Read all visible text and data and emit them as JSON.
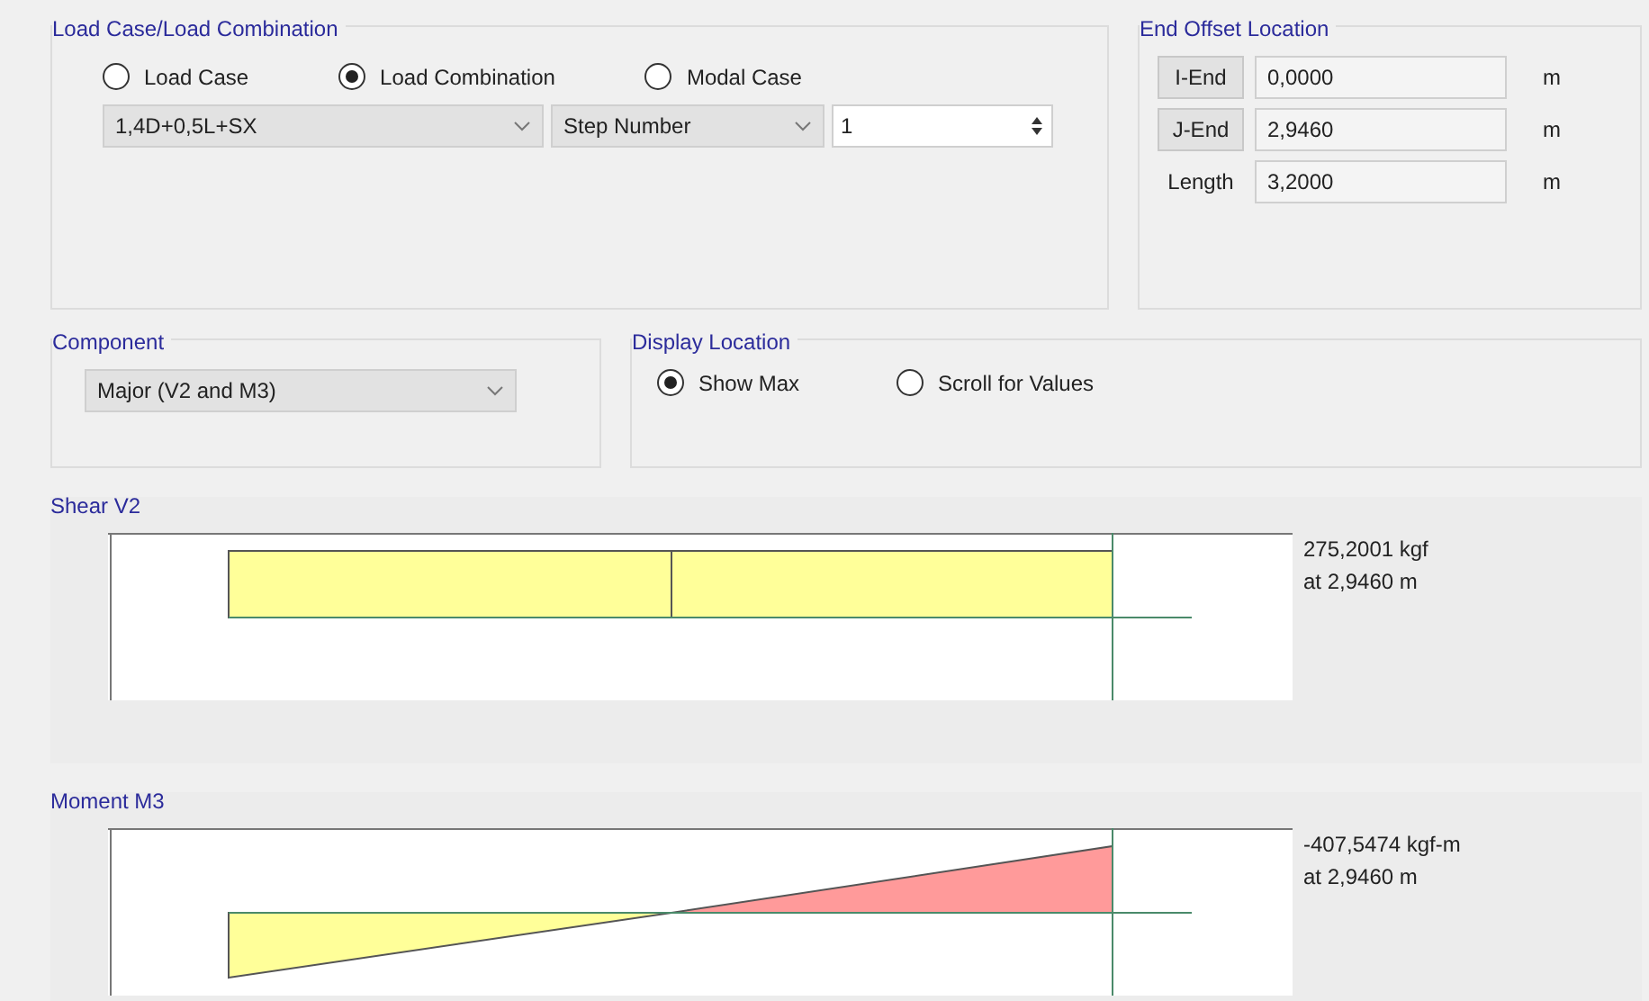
{
  "load_case_group": {
    "title": "Load Case/Load Combination",
    "options": [
      {
        "label": "Load Case",
        "selected": false
      },
      {
        "label": "Load Combination",
        "selected": true
      },
      {
        "label": "Modal Case",
        "selected": false
      }
    ],
    "combination": "1,4D+0,5L+SX",
    "step_type": "Step Number",
    "step_value": "1"
  },
  "end_offset": {
    "title": "End Offset Location",
    "rows": [
      {
        "label": "I-End",
        "kind": "button",
        "value": "0,0000",
        "unit": "m"
      },
      {
        "label": "J-End",
        "kind": "button",
        "value": "2,9460",
        "unit": "m"
      },
      {
        "label": "Length",
        "kind": "label",
        "value": "3,2000",
        "unit": "m"
      }
    ]
  },
  "component": {
    "title": "Component",
    "value": "Major (V2 and M3)"
  },
  "display_location": {
    "title": "Display Location",
    "options": [
      {
        "label": "Show Max",
        "selected": true
      },
      {
        "label": "Scroll for Values",
        "selected": false
      }
    ]
  },
  "diagrams": [
    {
      "title": "Shear V2",
      "kind": "shear",
      "value": "275,2001 kgf",
      "location": "at 2,9460 m"
    },
    {
      "title": "Moment M3",
      "kind": "moment",
      "value": "-407,5474 kgf-m",
      "location": "at 2,9460 m"
    }
  ]
}
